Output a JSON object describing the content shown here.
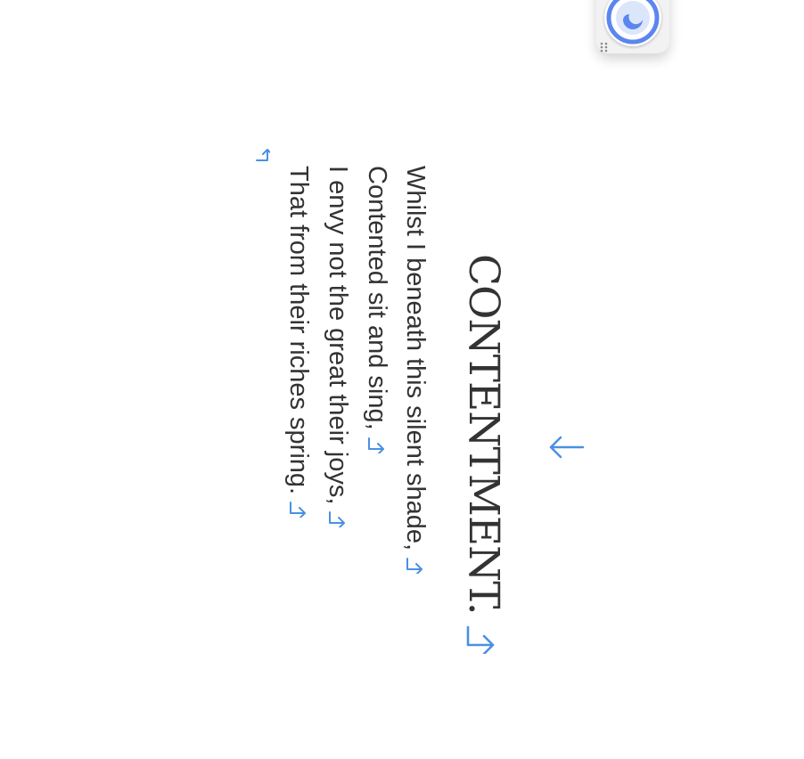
{
  "document": {
    "title": "CONTENTMENT.",
    "lines": [
      "Whilst I beneath this silent shade,",
      "Contented sit and sing,",
      "I envy not the great their joys,",
      "That from their riches spring."
    ]
  },
  "icons": {
    "paragraph_mark": "pilcrow-return-icon",
    "back": "left-arrow-icon",
    "widget": "assistant-orb-icon",
    "grip": "drag-grip-icon"
  },
  "colors": {
    "text": "#333333",
    "mark": "#4a90e2",
    "widget_ring": "#5b86f0"
  }
}
